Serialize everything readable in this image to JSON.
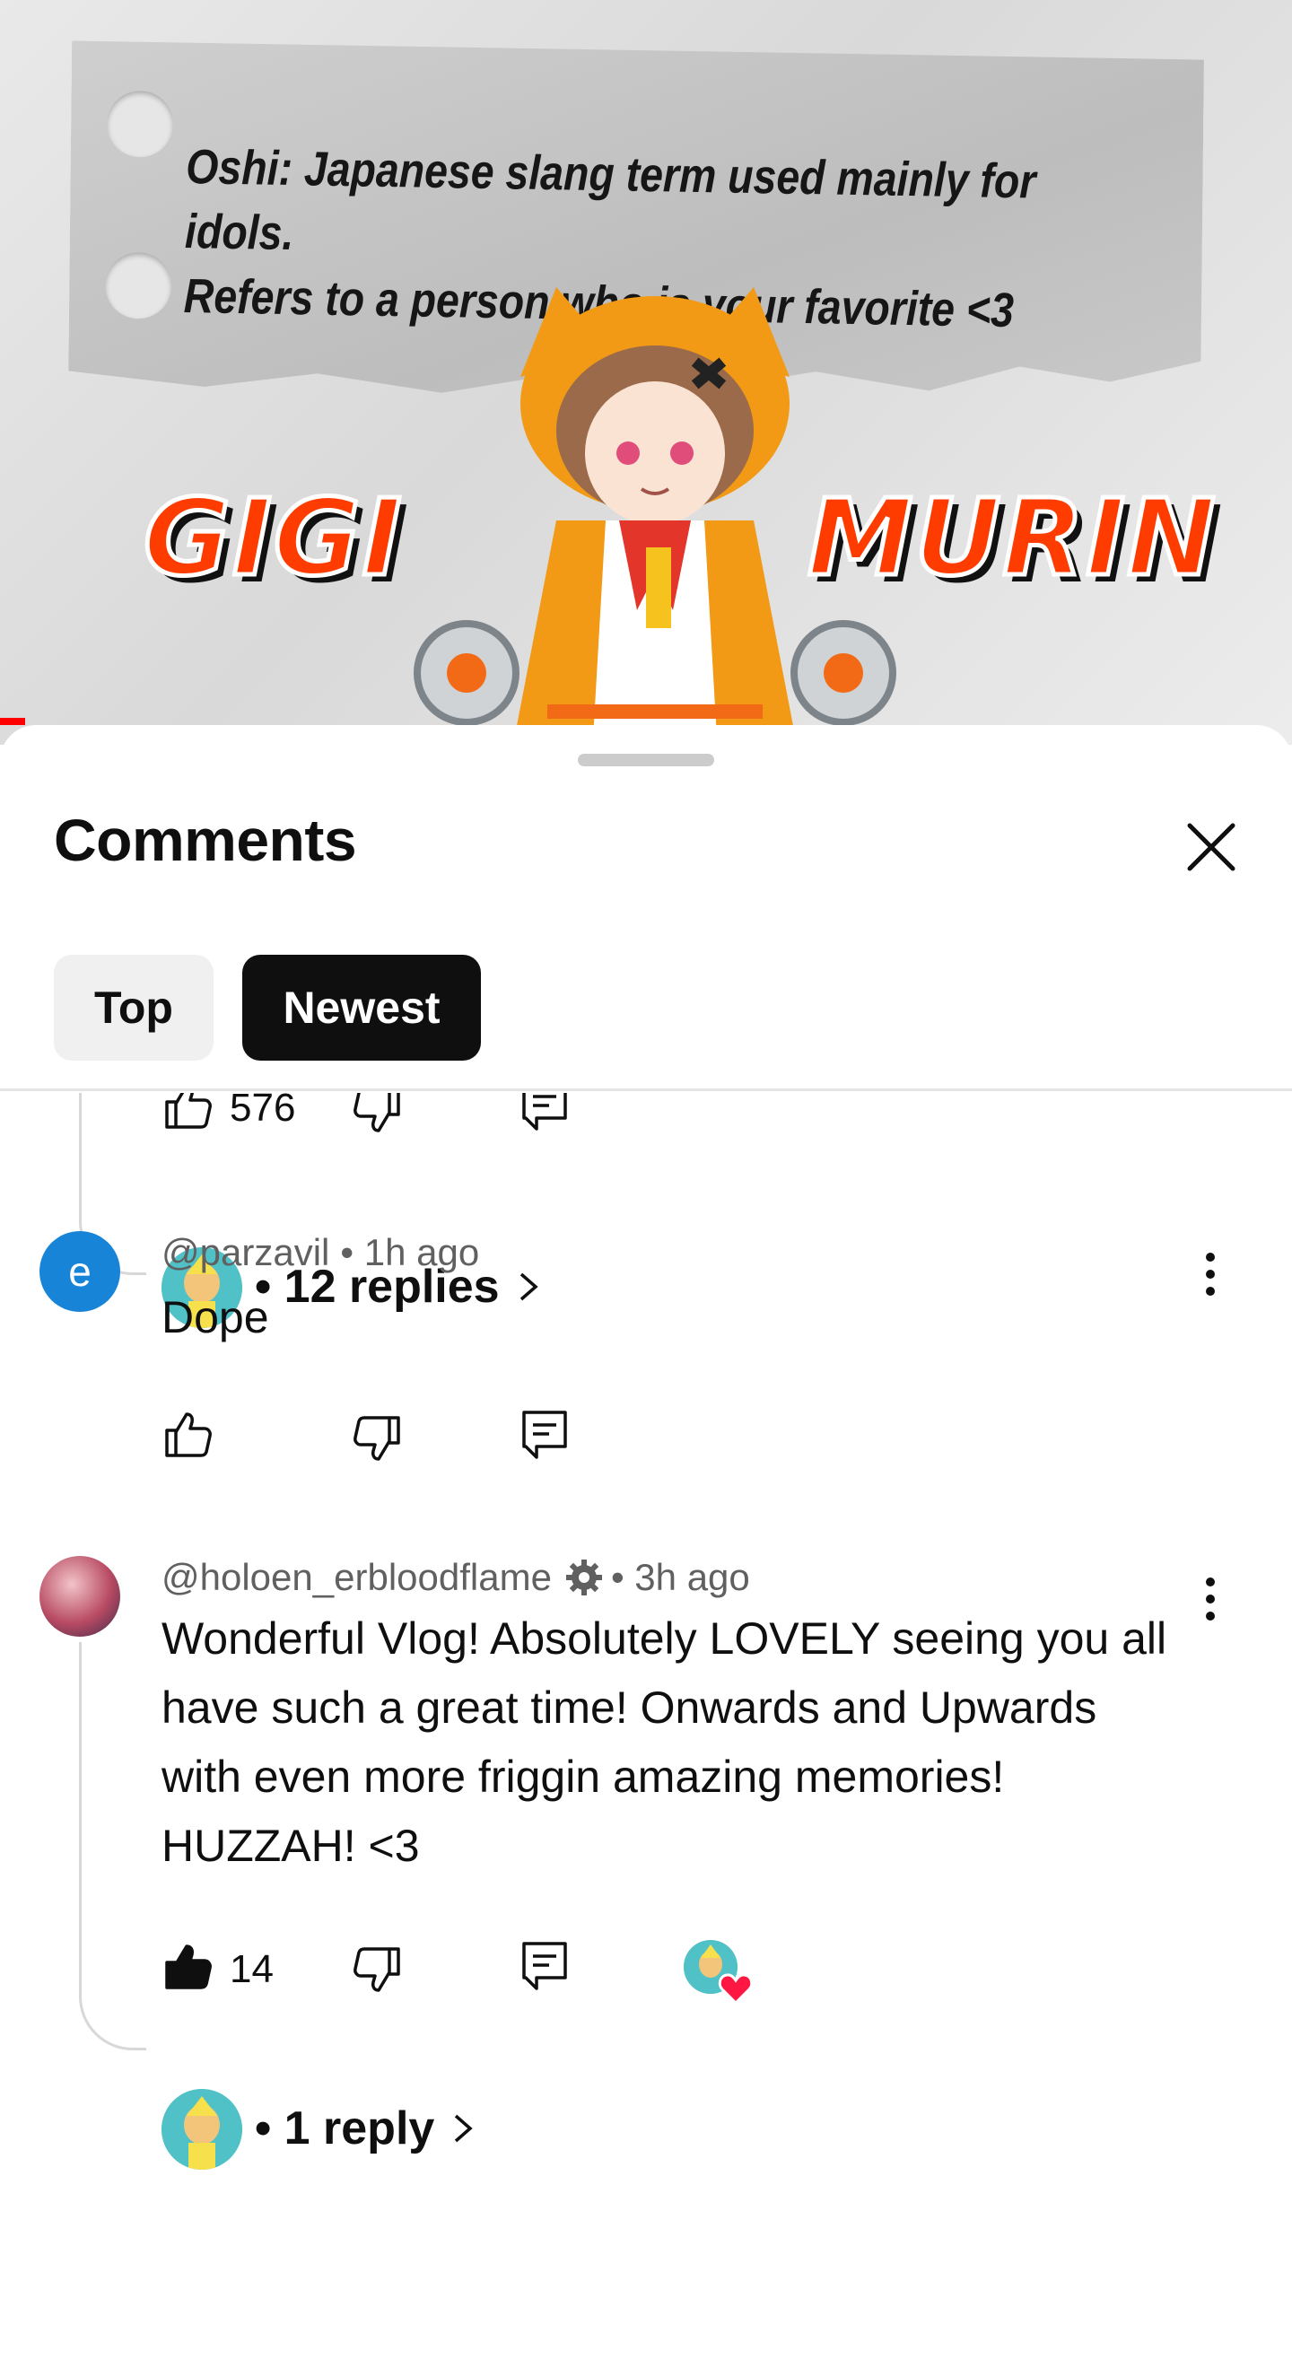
{
  "video": {
    "caption_lines": "Oshi: Japanese slang term used mainly for idols.\nRefers to a person who is your favorite <3",
    "name_left": "GIGI",
    "name_right": "MURIN"
  },
  "panel": {
    "title": "Comments",
    "chips": {
      "top": "Top",
      "newest": "Newest",
      "selected": "Newest"
    }
  },
  "thread0": {
    "like_count": "576",
    "replies_label": "• 12 replies"
  },
  "comments": [
    {
      "handle": "@parzavil",
      "time": "• 1h ago",
      "avatar_letter": "e",
      "avatar_color": "#1884d8",
      "text": "Dope",
      "like_count": ""
    },
    {
      "handle": "@holoen_erbloodflame",
      "time": "• 3h ago",
      "text": "Wonderful Vlog! Absolutely LOVELY seeing you all have such a great time! Onwards and Upwards with even more friggin amazing memories! HUZZAH! <3",
      "like_count": "14",
      "liked": true,
      "creator_hearted": true,
      "replies_label": "• 1 reply"
    }
  ],
  "colors": {
    "accent_red": "#ff0000",
    "chip_dark": "#0f0f0f",
    "meta_gray": "#606060",
    "heart": "#ff1744"
  }
}
